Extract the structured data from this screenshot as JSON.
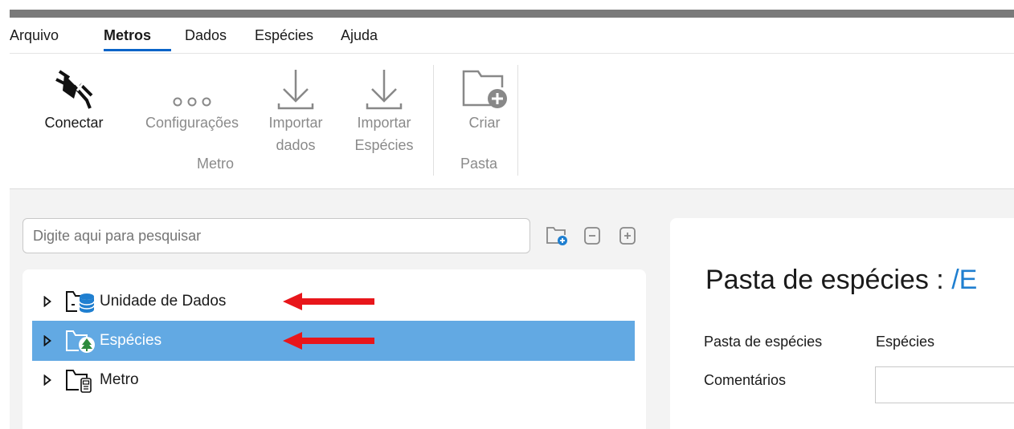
{
  "menu": {
    "items": [
      "Arquivo",
      "Metros",
      "Dados",
      "Espécies",
      "Ajuda"
    ],
    "active": "Metros"
  },
  "ribbon": {
    "connect_label": "Conectar",
    "settings_label": "Configurações",
    "import_data_label_1": "Importar",
    "import_data_label_2": "dados",
    "import_species_label_1": "Importar",
    "import_species_label_2": "Espécies",
    "create_label": "Criar",
    "group_meter": "Metro",
    "group_folder": "Pasta"
  },
  "search": {
    "placeholder": "Digite aqui para pesquisar"
  },
  "tree": {
    "items": [
      {
        "label": "Unidade de Dados",
        "icon": "data-unit-icon",
        "selected": false
      },
      {
        "label": "Espécies",
        "icon": "species-folder-icon",
        "selected": true
      },
      {
        "label": "Metro",
        "icon": "meter-folder-icon",
        "selected": false
      }
    ]
  },
  "detail": {
    "title": "Pasta de espécies",
    "title_sep": " : ",
    "title_path": "/E",
    "folder_label": "Pasta de espécies",
    "folder_value": "Espécies",
    "comments_label": "Comentários"
  },
  "colors": {
    "accent": "#0a64c8",
    "selection": "#62a9e3",
    "annotation_arrow": "#e8161b",
    "path": "#1f7fd0"
  }
}
